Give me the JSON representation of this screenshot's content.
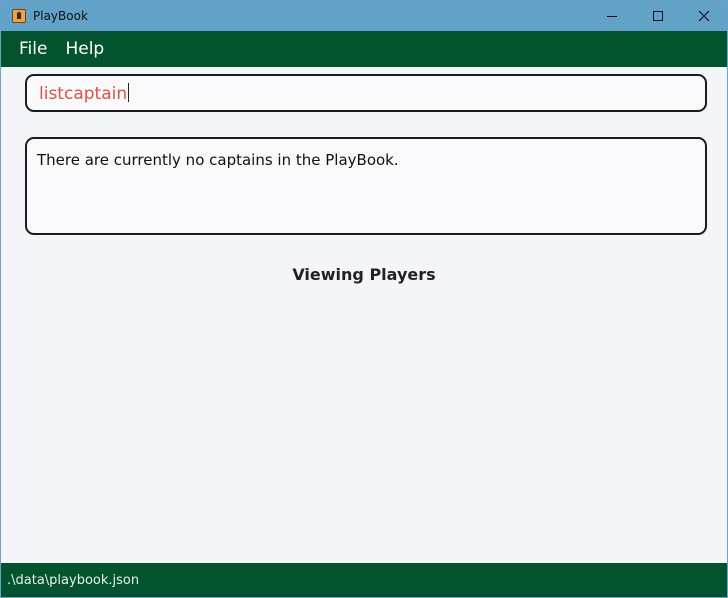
{
  "window": {
    "title": "PlayBook",
    "controls": [
      "minimize-icon",
      "maximize-icon",
      "close-icon"
    ]
  },
  "menu": {
    "items": [
      {
        "label": "File"
      },
      {
        "label": "Help"
      }
    ]
  },
  "command": {
    "value": "listcaptain",
    "text_color": "#d9534a"
  },
  "result": {
    "message": "There are currently no captains in the PlayBook."
  },
  "list": {
    "title": "Viewing Players",
    "players": []
  },
  "status": {
    "path": ".\\data\\playbook.json"
  },
  "colors": {
    "titlebar": "#62a2c9",
    "menubar": "#03532e",
    "statusbar": "#03532e",
    "background": "#f3f5f9"
  }
}
